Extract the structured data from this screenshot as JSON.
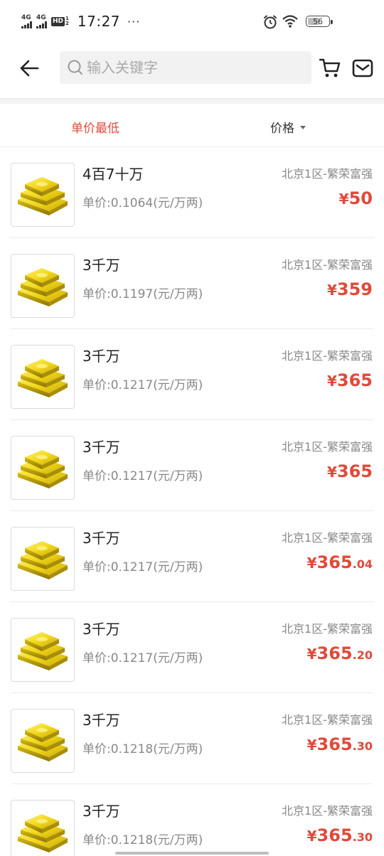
{
  "status_bar": {
    "signal1_label": "4G",
    "signal2_label": "4G",
    "hd_label": "HD",
    "hd_sub_top": "1",
    "hd_sub_bottom": "2",
    "time": "17:27",
    "dots": "···",
    "battery_level": "56"
  },
  "header": {
    "back_icon": "arrow-left-icon",
    "search_placeholder": "输入关键字",
    "cart_icon": "cart-icon",
    "mail_icon": "mail-icon"
  },
  "sort_bar": {
    "lowest_unit_price_label": "单价最低",
    "price_label": "价格"
  },
  "colors": {
    "accent_red": "#e04a3a"
  },
  "items": [
    {
      "title": "4百7十万",
      "unit_price": "单价:0.1064(元/万两)",
      "server": "北京1区-繁荣富强",
      "price_currency": "¥",
      "price_int": "50",
      "price_dec": ""
    },
    {
      "title": "3千万",
      "unit_price": "单价:0.1197(元/万两)",
      "server": "北京1区-繁荣富强",
      "price_currency": "¥",
      "price_int": "359",
      "price_dec": ""
    },
    {
      "title": "3千万",
      "unit_price": "单价:0.1217(元/万两)",
      "server": "北京1区-繁荣富强",
      "price_currency": "¥",
      "price_int": "365",
      "price_dec": ""
    },
    {
      "title": "3千万",
      "unit_price": "单价:0.1217(元/万两)",
      "server": "北京1区-繁荣富强",
      "price_currency": "¥",
      "price_int": "365",
      "price_dec": ""
    },
    {
      "title": "3千万",
      "unit_price": "单价:0.1217(元/万两)",
      "server": "北京1区-繁荣富强",
      "price_currency": "¥",
      "price_int": "365",
      "price_dec": ".04"
    },
    {
      "title": "3千万",
      "unit_price": "单价:0.1217(元/万两)",
      "server": "北京1区-繁荣富强",
      "price_currency": "¥",
      "price_int": "365",
      "price_dec": ".20"
    },
    {
      "title": "3千万",
      "unit_price": "单价:0.1218(元/万两)",
      "server": "北京1区-繁荣富强",
      "price_currency": "¥",
      "price_int": "365",
      "price_dec": ".30"
    },
    {
      "title": "3千万",
      "unit_price": "单价:0.1218(元/万两)",
      "server": "北京1区-繁荣富强",
      "price_currency": "¥",
      "price_int": "365",
      "price_dec": ".30"
    }
  ]
}
